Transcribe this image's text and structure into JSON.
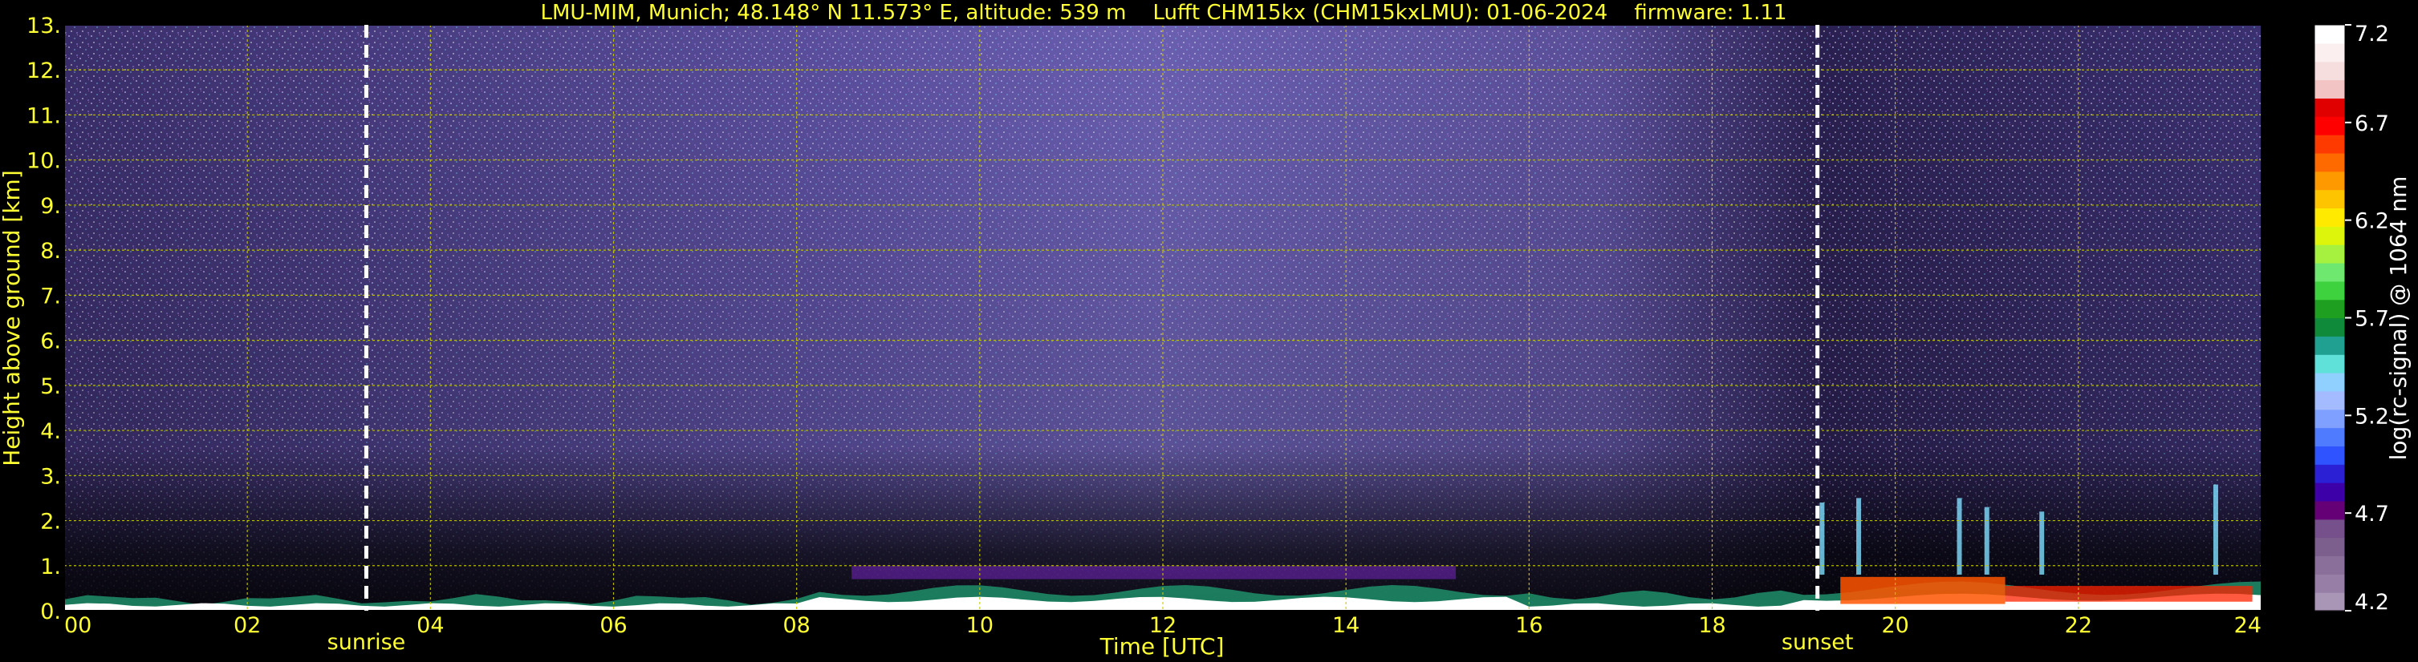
{
  "chart_data": {
    "type": "heatmap",
    "title": "LMU-MIM, Munich; 48.148° N 11.573° E, altitude: 539 m    Lufft CHM15kx (CHM15kxLMU): 01-06-2024    firmware: 1.11",
    "xlabel": "Time [UTC]",
    "ylabel": "Height above ground [km]",
    "xlim": [
      0,
      24
    ],
    "ylim": [
      0,
      13
    ],
    "x_ticks": [
      0,
      2,
      4,
      6,
      8,
      10,
      12,
      14,
      16,
      18,
      20,
      22,
      24
    ],
    "x_tick_labels": [
      "00",
      "02",
      "04",
      "06",
      "08",
      "10",
      "12",
      "14",
      "16",
      "18",
      "20",
      "22",
      "24"
    ],
    "y_ticks": [
      0,
      1,
      2,
      3,
      4,
      5,
      6,
      7,
      8,
      9,
      10,
      11,
      12,
      13
    ],
    "y_tick_labels": [
      "0.",
      "1.",
      "2.",
      "3.",
      "4.",
      "5.",
      "6.",
      "7.",
      "8.",
      "9.",
      "10.",
      "11.",
      "12.",
      "13."
    ],
    "grid": true,
    "annotations": [
      {
        "text": "sunrise",
        "x": 3.3
      },
      {
        "text": "sunset",
        "x": 19.15
      }
    ],
    "colorbar": {
      "label": "log(rc-signal) @ 1064 nm",
      "range": [
        4.2,
        7.2
      ],
      "ticks": [
        4.2,
        4.7,
        5.2,
        5.7,
        6.2,
        6.7,
        7.2
      ],
      "tick_labels": [
        "4.2",
        "4.7",
        "5.2",
        "5.7",
        "6.2",
        "6.7",
        "7.2"
      ]
    },
    "colors": {
      "accent": "#ffff33",
      "grid": "#cccc00",
      "background": "#000000"
    }
  }
}
